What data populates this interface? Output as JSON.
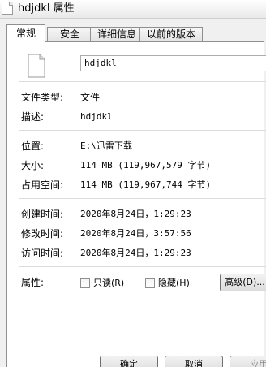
{
  "window": {
    "title": "hdjdkl 属性"
  },
  "tabs": [
    {
      "label": "常规"
    },
    {
      "label": "安全"
    },
    {
      "label": "详细信息"
    },
    {
      "label": "以前的版本"
    }
  ],
  "general": {
    "file_name": "hdjdkl",
    "rows": {
      "type": {
        "label": "文件类型:",
        "value": "文件"
      },
      "description": {
        "label": "描述:",
        "value": "hdjdkl"
      },
      "location": {
        "label": "位置:",
        "value": "E:\\迅雷下载"
      },
      "size": {
        "label": "大小:",
        "value": "114 MB (119,967,579 字节)"
      },
      "size_on_disk": {
        "label": "占用空间:",
        "value": "114 MB (119,967,744 字节)"
      },
      "created": {
        "label": "创建时间:",
        "value": "2020年8月24日，1:29:23"
      },
      "modified": {
        "label": "修改时间:",
        "value": "2020年8月24日，3:57:56"
      },
      "accessed": {
        "label": "访问时间:",
        "value": "2020年8月24日，1:29:23"
      },
      "attributes": {
        "label": "属性:"
      }
    },
    "attributes": {
      "readonly_label": "只读(R)",
      "hidden_label": "隐藏(H)",
      "advanced_label": "高级(D)..."
    }
  },
  "footer": {
    "ok_label": "确定",
    "cancel_label": "取消",
    "apply_label": "应用"
  }
}
